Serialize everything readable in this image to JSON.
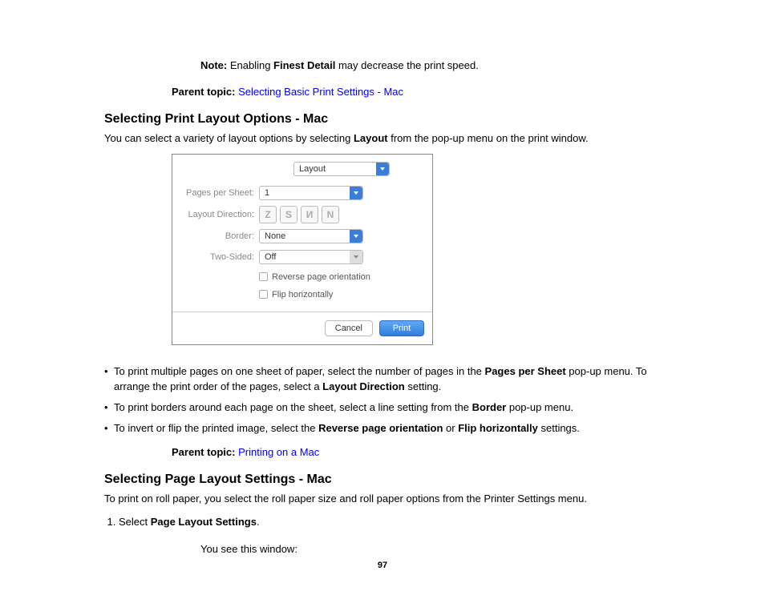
{
  "note": {
    "label": "Note:",
    "pre": " Enabling ",
    "bold": "Finest Detail",
    "post": " may decrease the print speed."
  },
  "parent1": {
    "label": "Parent topic:",
    "link": "Selecting Basic Print Settings - Mac"
  },
  "sec1": {
    "heading": "Selecting Print Layout Options - Mac",
    "intro_pre": "You can select a variety of layout options by selecting ",
    "intro_bold": "Layout",
    "intro_post": " from the pop-up menu on the print window."
  },
  "dialog": {
    "menu": "Layout",
    "labels": {
      "pps": "Pages per Sheet:",
      "ld": "Layout Direction:",
      "border": "Border:",
      "ts": "Two-Sided:"
    },
    "pps_val": "1",
    "border_val": "None",
    "ts_val": "Off",
    "icons": [
      "Z",
      "S",
      "И",
      "N"
    ],
    "chk1": "Reverse page orientation",
    "chk2": "Flip horizontally",
    "cancel": "Cancel",
    "print": "Print"
  },
  "bullets": {
    "b1a": "To print multiple pages on one sheet of paper, select the number of pages in the ",
    "b1b": "Pages per Sheet",
    "b1c": " pop-up menu. To arrange the print order of the pages, select a ",
    "b1d": "Layout Direction",
    "b1e": " setting.",
    "b2a": "To print borders around each page on the sheet, select a line setting from the ",
    "b2b": "Border",
    "b2c": " pop-up menu.",
    "b3a": "To invert or flip the printed image, select the ",
    "b3b": "Reverse page orientation",
    "b3c": " or ",
    "b3d": "Flip horizontally",
    "b3e": " settings."
  },
  "parent2": {
    "label": "Parent topic:",
    "link": "Printing on a Mac"
  },
  "sec2": {
    "heading": "Selecting Page Layout Settings - Mac",
    "intro": "To print on roll paper, you select the roll paper size and roll paper options from the Printer Settings menu.",
    "step1_pre": "Select ",
    "step1_bold": "Page Layout Settings",
    "step1_post": ".",
    "after": "You see this window:"
  },
  "page_number": "97"
}
